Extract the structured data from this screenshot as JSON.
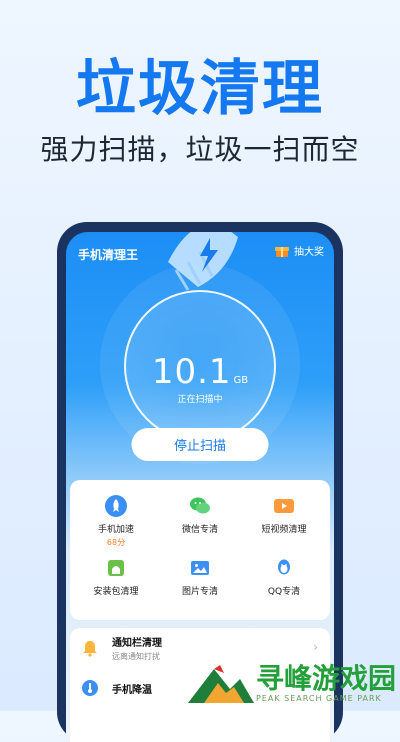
{
  "promo": {
    "headline": "垃圾清理",
    "subline": "强力扫描，垃圾一扫而空"
  },
  "app": {
    "title": "手机清理王",
    "lottery_label": "抽大奖"
  },
  "scan": {
    "amount": "10.1",
    "unit": "GB",
    "status": "正在扫描中",
    "stop_label": "停止扫描"
  },
  "features": [
    {
      "label": "手机加速",
      "sub": "68分",
      "icon": "rocket-icon",
      "color": "#3b8ff5"
    },
    {
      "label": "微信专清",
      "sub": "",
      "icon": "wechat-icon",
      "color": "#3cc35c"
    },
    {
      "label": "短视频清理",
      "sub": "",
      "icon": "video-icon",
      "color": "#ff9a3c"
    },
    {
      "label": "安装包清理",
      "sub": "",
      "icon": "android-icon",
      "color": "#6cc04a"
    },
    {
      "label": "图片专清",
      "sub": "",
      "icon": "image-icon",
      "color": "#3b8ff5"
    },
    {
      "label": "QQ专清",
      "sub": "",
      "icon": "qq-icon",
      "color": "#3b8ff5"
    }
  ],
  "list": [
    {
      "title": "通知栏清理",
      "desc": "远离通知打扰",
      "icon": "bell-icon"
    },
    {
      "title": "手机降温",
      "desc": "",
      "icon": "thermometer-icon"
    }
  ],
  "watermark": {
    "main": "寻峰游戏园",
    "sub": "PEAK SEARCH GAME PARK"
  },
  "colors": {
    "brand_blue": "#1478f0",
    "accent_orange": "#ff7a2d",
    "watermark_green": "#23a03a"
  }
}
